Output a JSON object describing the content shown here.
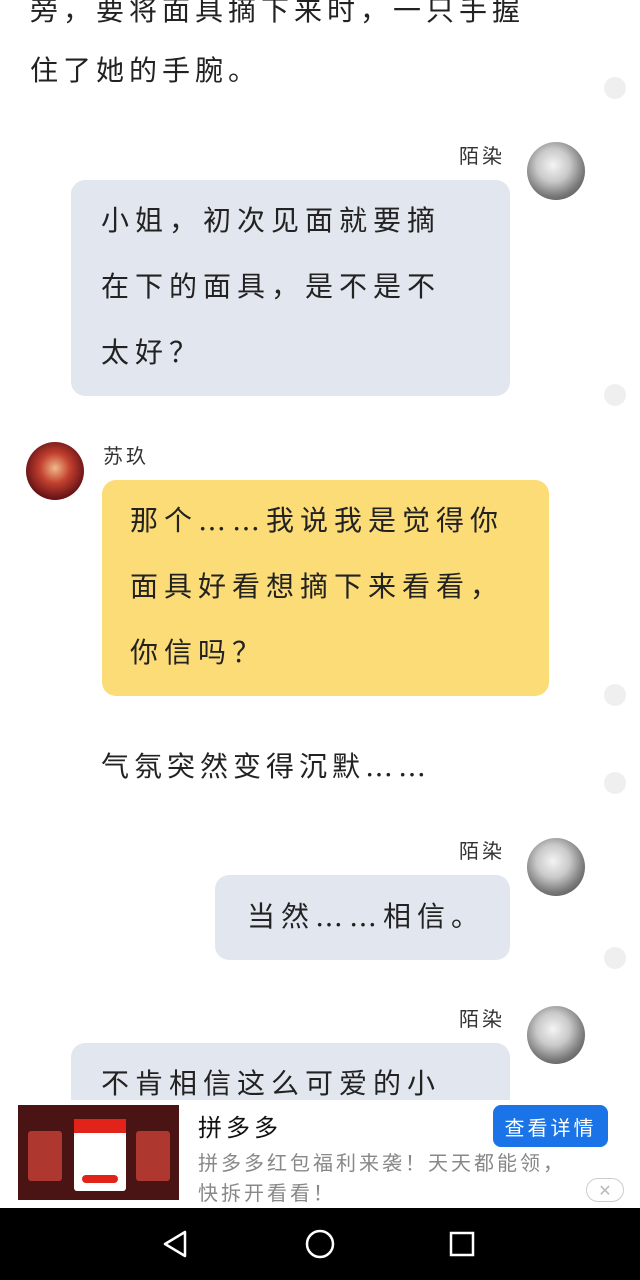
{
  "narration": {
    "line1": "旁，要将面具摘下来时，一只手握",
    "line2": "住了她的手腕。",
    "silence": "气氛突然变得沉默……"
  },
  "messages": [
    {
      "sender": "陌染",
      "lines": [
        "小姐，初次见面就要摘",
        "在下的面具，是不是不",
        "太好？"
      ]
    },
    {
      "sender": "苏玖",
      "lines": [
        "那个……我说我是觉得你",
        "面具好看想摘下来看看，",
        "你信吗？"
      ]
    },
    {
      "sender": "陌染",
      "lines": [
        "当然……相信。"
      ]
    },
    {
      "sender": "陌染",
      "lines": [
        "不肯相信这么可爱的小"
      ]
    }
  ],
  "ad": {
    "title": "拼多多",
    "description": "拼多多红包福利来袭！天天都能领，快拆开看看！",
    "button": "查看详情",
    "close": "✕",
    "image_icon": "pinduoduo-promo-image"
  },
  "navbar": {
    "back_icon": "back-triangle-icon",
    "home_icon": "home-circle-icon",
    "recents_icon": "recents-square-icon"
  },
  "colors": {
    "bubble_grey": "#e2e7ef",
    "bubble_yellow": "#fcdc76",
    "ad_button": "#1b73e8"
  }
}
